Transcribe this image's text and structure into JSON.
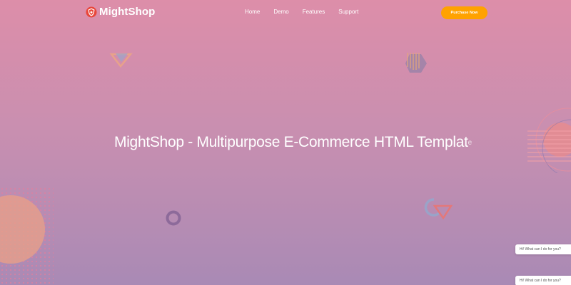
{
  "brand": {
    "name": "MightShop",
    "logo_icon": "shield-logo-icon",
    "colors": {
      "accent": "#ffa200",
      "logo": "#e8463a"
    }
  },
  "nav": {
    "items": [
      {
        "label": "Home"
      },
      {
        "label": "Demo"
      },
      {
        "label": "Features"
      },
      {
        "label": "Support"
      }
    ],
    "cta_label": "Purchase Now"
  },
  "hero": {
    "title": "MightShop - Multipurpose E-Commerce HTML Templat",
    "title_cursor": "e"
  },
  "chat_widget": {
    "messages": [
      {
        "text": "Hi! What can I do for you?"
      },
      {
        "text": "Hi! What can I do for you?"
      }
    ]
  },
  "background": {
    "gradient_top": "#dd8ea9",
    "gradient_bottom": "#a98ab5"
  }
}
